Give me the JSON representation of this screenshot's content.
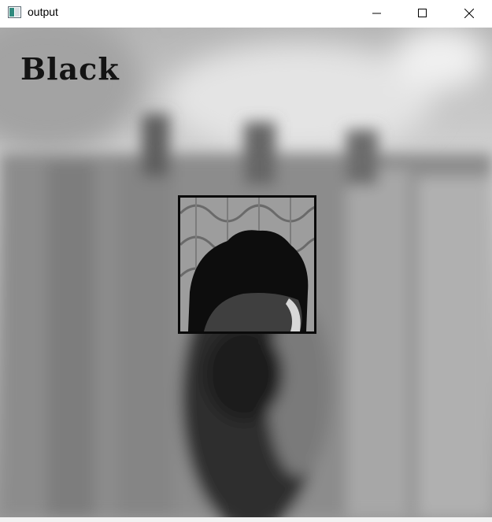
{
  "window": {
    "title": "output",
    "icon": "opencv-window-icon",
    "controls": {
      "minimize": "minimize-icon",
      "maximize": "maximize-icon",
      "close": "close-icon"
    }
  },
  "frame": {
    "label": "Black",
    "colors": {
      "label": "#141414",
      "box": "#0a0a0a"
    }
  }
}
